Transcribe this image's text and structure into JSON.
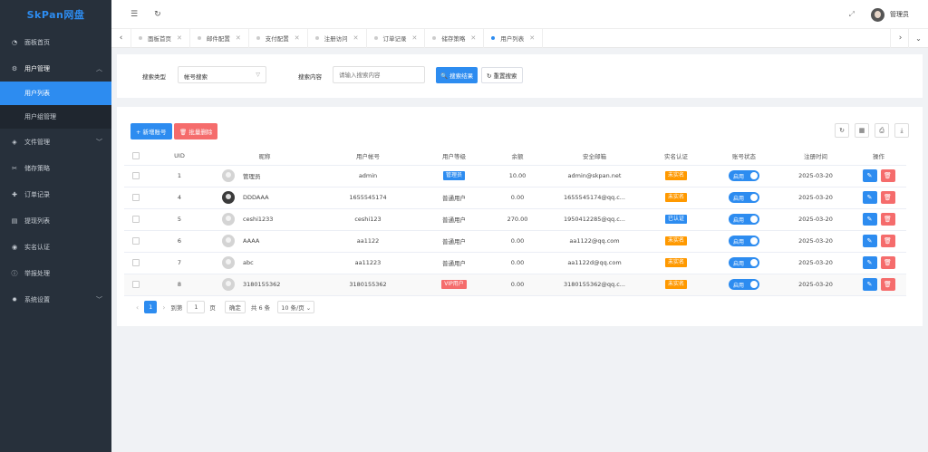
{
  "app": {
    "logo": "SkPan网盘"
  },
  "sidebar": {
    "items": [
      {
        "label": "面板首页",
        "icon": "dashboard-icon",
        "glyph": "◔"
      },
      {
        "label": "用户管理",
        "icon": "gear-icon",
        "glyph": "⚙",
        "chev": "︿"
      },
      {
        "label": "文件管理",
        "icon": "layers-icon",
        "glyph": "◈",
        "chev": "﹀"
      },
      {
        "label": "储存策略",
        "icon": "strategy-icon",
        "glyph": "✂"
      },
      {
        "label": "订单记录",
        "icon": "cart-icon",
        "glyph": "✚"
      },
      {
        "label": "提现列表",
        "icon": "list-icon",
        "glyph": "▤"
      },
      {
        "label": "实名认证",
        "icon": "verified-icon",
        "glyph": "◉"
      },
      {
        "label": "举报处理",
        "icon": "report-icon",
        "glyph": "ⓘ"
      },
      {
        "label": "系统设置",
        "icon": "settings-icon",
        "glyph": "✹",
        "chev": "﹀"
      }
    ],
    "sub_user_list": "用户列表",
    "sub_user_group": "用户组管理"
  },
  "header": {
    "menu_glyph": "☰",
    "refresh_glyph": "↻",
    "fullscreen_glyph": "⤢",
    "username": "管理员"
  },
  "tabs": {
    "left_arrow": "‹",
    "right_arrow": "›",
    "more": "⌄",
    "close": "✕",
    "items": [
      "面板首页",
      "邮件配置",
      "支付配置",
      "注册访问",
      "订单记录",
      "储存策略",
      "用户列表"
    ]
  },
  "search": {
    "type_label": "搜索类型",
    "type_value": "帐号搜索",
    "type_arrow": "▽",
    "content_label": "搜索内容",
    "content_placeholder": "请输入搜索内容",
    "search_btn": "🔍 搜索结果",
    "reset_btn": "↻ 重置搜索"
  },
  "toolbar": {
    "add": "+ 新增账号",
    "batch_delete": "🗑 批量删除",
    "icons": [
      {
        "name": "refresh-icon",
        "glyph": "↻"
      },
      {
        "name": "filter-columns-icon",
        "glyph": "▦"
      },
      {
        "name": "print-icon",
        "glyph": "⎙"
      },
      {
        "name": "export-icon",
        "glyph": "⤓"
      }
    ]
  },
  "table": {
    "columns": [
      "UID",
      "昵称",
      "用户帐号",
      "用户等级",
      "余额",
      "安全邮箱",
      "实名认证",
      "账号状态",
      "注册时间",
      "操作"
    ],
    "rows": [
      {
        "uid": "1",
        "nick": "管理员",
        "account": "admin",
        "level": "管理员",
        "level_color": "blue",
        "balance": "10.00",
        "email": "admin@skpan.net",
        "realname": "未实名",
        "realname_color": "orange",
        "status": "启用",
        "date": "2025-03-20",
        "dark": false
      },
      {
        "uid": "4",
        "nick": "DDDAAA",
        "account": "1655545174",
        "level": "普通用户",
        "level_color": "",
        "balance": "0.00",
        "email": "1655545174@qq.c...",
        "realname": "未实名",
        "realname_color": "orange",
        "status": "启用",
        "date": "2025-03-20",
        "dark": true
      },
      {
        "uid": "5",
        "nick": "ceshi1233",
        "account": "ceshi123",
        "level": "普通用户",
        "level_color": "",
        "balance": "270.00",
        "email": "1950412285@qq.c...",
        "realname": "已认证",
        "realname_color": "teal",
        "status": "启用",
        "date": "2025-03-20",
        "dark": false
      },
      {
        "uid": "6",
        "nick": "AAAA",
        "account": "aa1122",
        "level": "普通用户",
        "level_color": "",
        "balance": "0.00",
        "email": "aa1122@qq.com",
        "realname": "未实名",
        "realname_color": "orange",
        "status": "启用",
        "date": "2025-03-20",
        "dark": false
      },
      {
        "uid": "7",
        "nick": "abc",
        "account": "aa11223",
        "level": "普通用户",
        "level_color": "",
        "balance": "0.00",
        "email": "aa1122d@qq.com",
        "realname": "未实名",
        "realname_color": "orange",
        "status": "启用",
        "date": "2025-03-20",
        "dark": false
      },
      {
        "uid": "8",
        "nick": "3180155362",
        "account": "3180155362",
        "level": "VIP用户",
        "level_color": "red",
        "balance": "0.00",
        "email": "3180155362@qq.c...",
        "realname": "未实名",
        "realname_color": "orange",
        "status": "启用",
        "date": "2025-03-20",
        "dark": false
      }
    ],
    "edit_glyph": "✎",
    "delete_glyph": "🗑"
  },
  "pager": {
    "prev": "‹",
    "current": "1",
    "next": "›",
    "goto_label": "到第",
    "goto_value": "1",
    "page_unit": "页",
    "confirm": "确定",
    "total": "共 6 条",
    "per_page": "10 条/页 ⌄"
  }
}
